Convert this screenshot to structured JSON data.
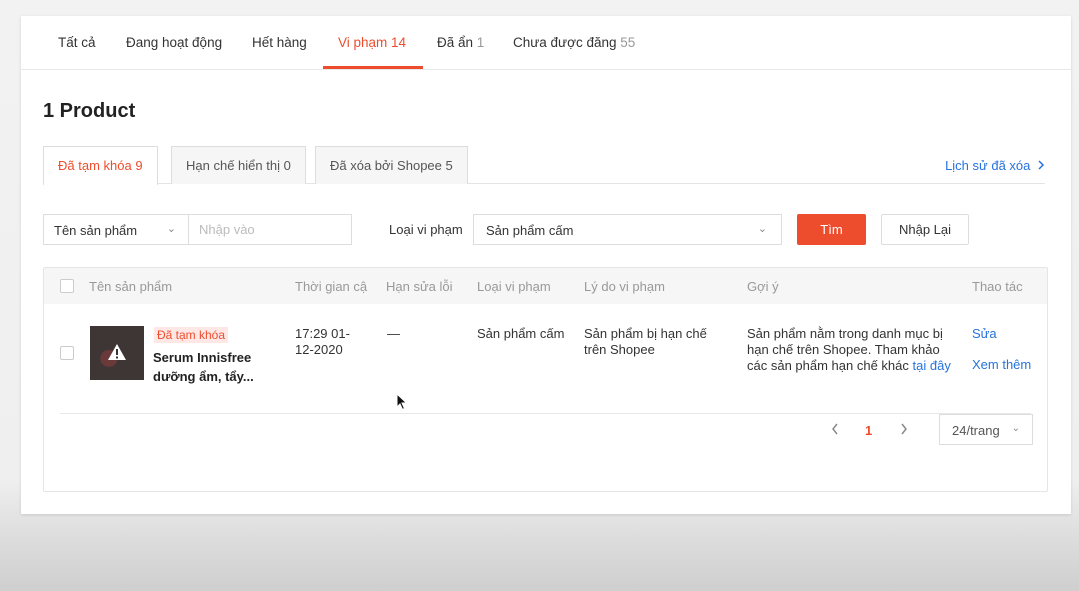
{
  "status_tabs": [
    {
      "label": "Tất cả",
      "count": ""
    },
    {
      "label": "Đang hoạt động",
      "count": ""
    },
    {
      "label": "Hết hàng",
      "count": ""
    },
    {
      "label": "Vi phạm",
      "count": "14"
    },
    {
      "label": "Đã ẩn",
      "count": "1"
    },
    {
      "label": "Chưa được đăng",
      "count": "55"
    }
  ],
  "active_status_tab": "Vi phạm",
  "heading": "1 Product",
  "sub_tabs": [
    {
      "label": "Đã tạm khóa",
      "count": "9"
    },
    {
      "label": "Hạn chế hiển thị",
      "count": "0"
    },
    {
      "label": "Đã xóa bởi Shopee",
      "count": "5"
    }
  ],
  "active_sub_tab": "Đã tạm khóa",
  "history_link": "Lịch sử đã xóa",
  "filters": {
    "name_field_select": "Tên sản phẩm",
    "name_input_placeholder": "Nhập vào",
    "violation_label": "Loại vi phạm",
    "violation_select": "Sản phẩm cấm",
    "search_button": "Tìm",
    "reset_button": "Nhập Lại"
  },
  "table": {
    "headers": [
      "Tên sản phẩm",
      "Thời gian cậ",
      "Hạn sửa lỗi",
      "Loại vi phạm",
      "Lý do vi phạm",
      "Gợi ý",
      "Thao tác"
    ],
    "rows": [
      {
        "status_badge": "Đã tạm khóa",
        "name": "Serum Innisfree dưỡng ẩm, tẩy...",
        "updated_time": "17:29 01-12-2020",
        "fix_deadline": "—",
        "violation_type": "Sản phẩm cấm",
        "violation_reason": "Sản phẩm bị hạn chế trên Shopee",
        "suggestion": "Sản phẩm nằm trong danh mục bị hạn chế trên Shopee. Tham khảo các sản phẩm hạn chế khác",
        "suggestion_link": "tại đây",
        "action_edit": "Sửa",
        "action_more": "Xem thêm"
      }
    ]
  },
  "pagination": {
    "current_page": "1",
    "page_size": "24/trang"
  },
  "colors": {
    "accent": "#ee4d2d",
    "link": "#2673dd"
  }
}
